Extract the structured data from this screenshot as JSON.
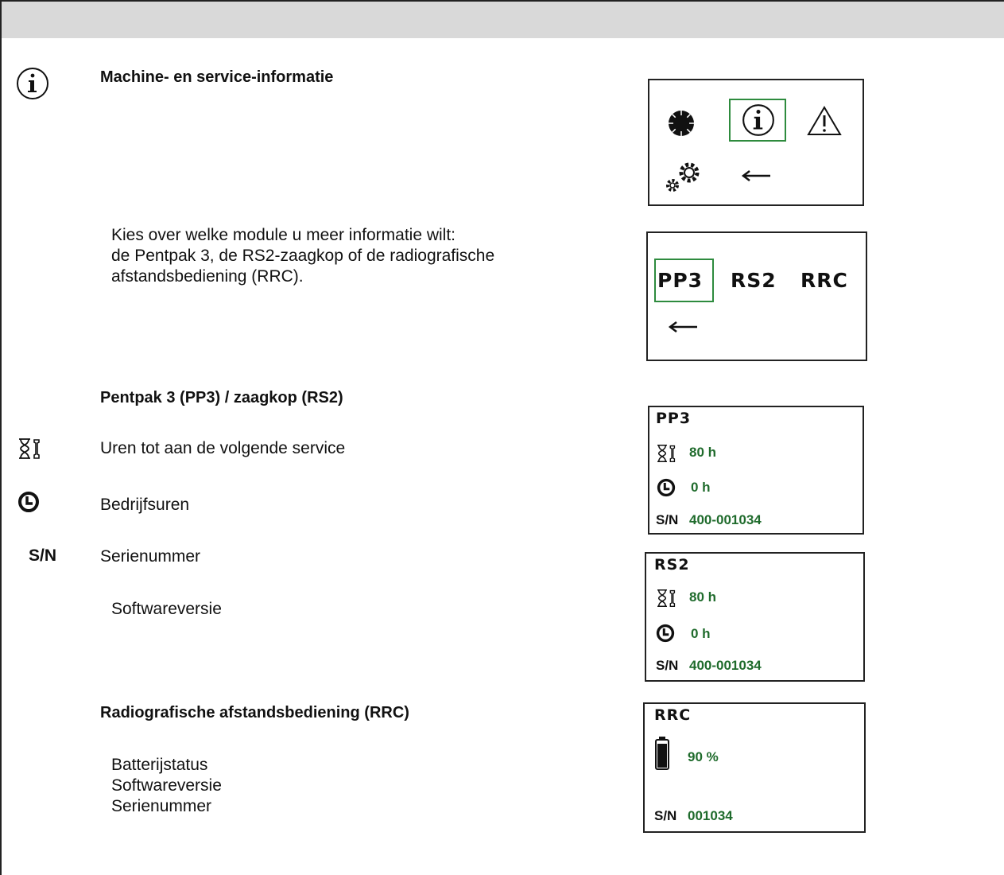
{
  "title": "Machine- en service-informatie",
  "module_choice": {
    "lines": [
      "Kies over welke module u meer informatie wilt:",
      "de Pentpak 3, de RS2-zaagkop of de radiografische",
      "afstandsbediening (RRC)."
    ]
  },
  "pp3_rs2": {
    "heading": "Pentpak 3 (PP3) / zaagkop (RS2)",
    "items": {
      "service_hours": "Uren tot aan de volgende service",
      "operating_hours": "Bedrijfsuren",
      "serial": "Serienummer",
      "software": "Softwareversie"
    },
    "sn_symbol": "S/N"
  },
  "rrc": {
    "heading": "Radiografische afstandsbediening (RRC)",
    "items": [
      "Batterijstatus",
      "Softwareversie",
      "Serienummer"
    ]
  },
  "menu_screen": {
    "icons": [
      "blade-icon",
      "info-icon",
      "warning-icon",
      "gears-icon",
      "back-arrow-icon"
    ],
    "selected": "info-icon",
    "back_label": "←"
  },
  "module_screen": {
    "options": [
      "PP3",
      "RS2",
      "RRC"
    ],
    "selected": "PP3",
    "back_label": "←"
  },
  "screens": {
    "pp3": {
      "title": "PP3",
      "service_hours": "80 h",
      "operating_hours": "0 h",
      "sn_label": "S/N",
      "serial": "400-001034"
    },
    "rs2": {
      "title": "RS2",
      "service_hours": "80 h",
      "operating_hours": "0 h",
      "sn_label": "S/N",
      "serial": "400-001034"
    },
    "rrc": {
      "title": "RRC",
      "battery": "90 %",
      "battery_level": 0.9,
      "sn_label": "S/N",
      "serial": "001034"
    }
  },
  "colors": {
    "accent": "#2e8b3e",
    "value_text": "#1f6b2c",
    "header_bar": "#d9d9d9"
  }
}
